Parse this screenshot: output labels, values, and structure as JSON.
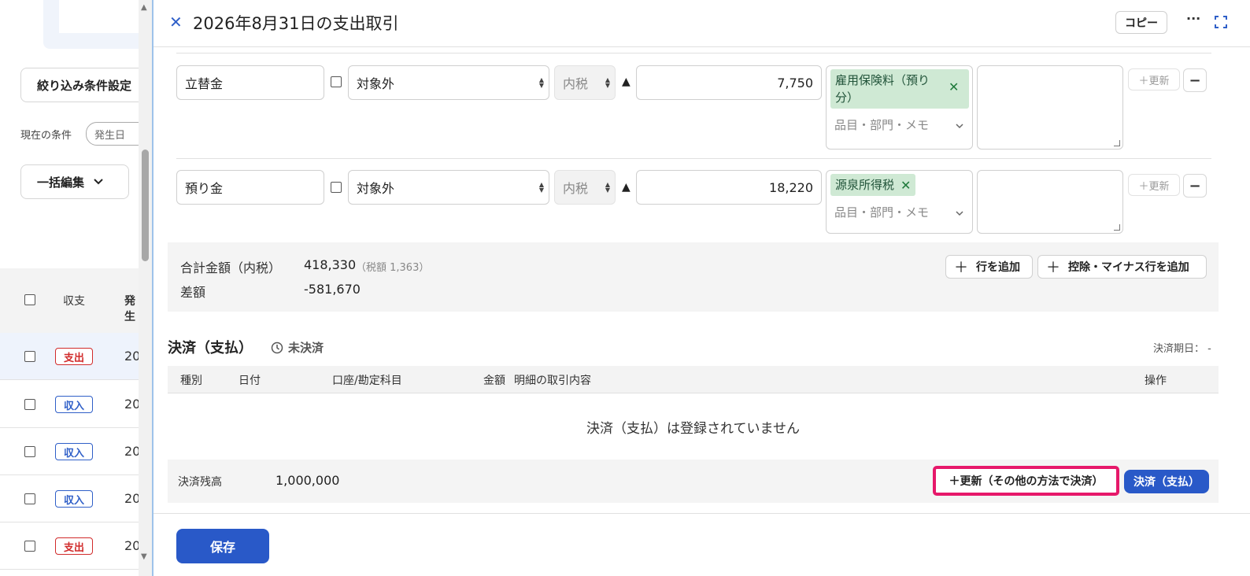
{
  "left_panel": {
    "filter_button": "絞り込み条件設定",
    "current_conditions_label": "現在の条件",
    "condition_pill": "発生日",
    "bulk_edit_button": "一括編集",
    "table_header": {
      "type": "収支",
      "date": "発生"
    },
    "rows": [
      {
        "type": "支出",
        "kind": "out",
        "date": "20"
      },
      {
        "type": "収入",
        "kind": "in",
        "date": "20"
      },
      {
        "type": "収入",
        "kind": "in",
        "date": "20"
      },
      {
        "type": "収入",
        "kind": "in",
        "date": "20"
      },
      {
        "type": "支出",
        "kind": "out",
        "date": "20"
      }
    ]
  },
  "header": {
    "title": "2026年8月31日の支出取引",
    "copy_button": "コピー",
    "more_icon": "ellipsis-icon",
    "expand_icon": "expand-icon"
  },
  "detail_rows": [
    {
      "account": "立替金",
      "tax_category": "対象外",
      "tax_method": "内税",
      "sign": "▲",
      "amount": "7,750",
      "tag": "雇用保険料（預り分）",
      "tag_placeholder": "品目・部門・メモ",
      "update_button": "＋更新",
      "remove_button": "−"
    },
    {
      "account": "預り金",
      "tax_category": "対象外",
      "tax_method": "内税",
      "sign": "▲",
      "amount": "18,220",
      "tag": "源泉所得税",
      "tag_placeholder": "品目・部門・メモ",
      "update_button": "＋更新",
      "remove_button": "−"
    }
  ],
  "totals": {
    "total_label": "合計金額（内税）",
    "total_value": "418,330",
    "tax_note": "（税額 1,363）",
    "diff_label": "差額",
    "diff_value": "-581,670",
    "add_row_button": "行を追加",
    "add_minus_row_button": "控除・マイナス行を追加"
  },
  "settlement": {
    "title": "決済（支払）",
    "status": "未決済",
    "due_label": "決済期日：",
    "due_value": "-",
    "columns": [
      "種別",
      "日付",
      "口座/勘定科目",
      "金額",
      "明細の取引内容",
      "操作"
    ],
    "empty_message": "決済（支払）は登録されていません",
    "balance_label": "決済残高",
    "balance_value": "1,000,000",
    "other_method_button": "＋更新（その他の方法で決済）",
    "pay_button": "決済（支払）"
  },
  "save_button": "保存",
  "colors": {
    "accent": "#2959c8",
    "highlight": "#e6186a",
    "tag_bg": "#cfe9d4",
    "expense": "#d12b2b",
    "income": "#2f5fc8"
  }
}
